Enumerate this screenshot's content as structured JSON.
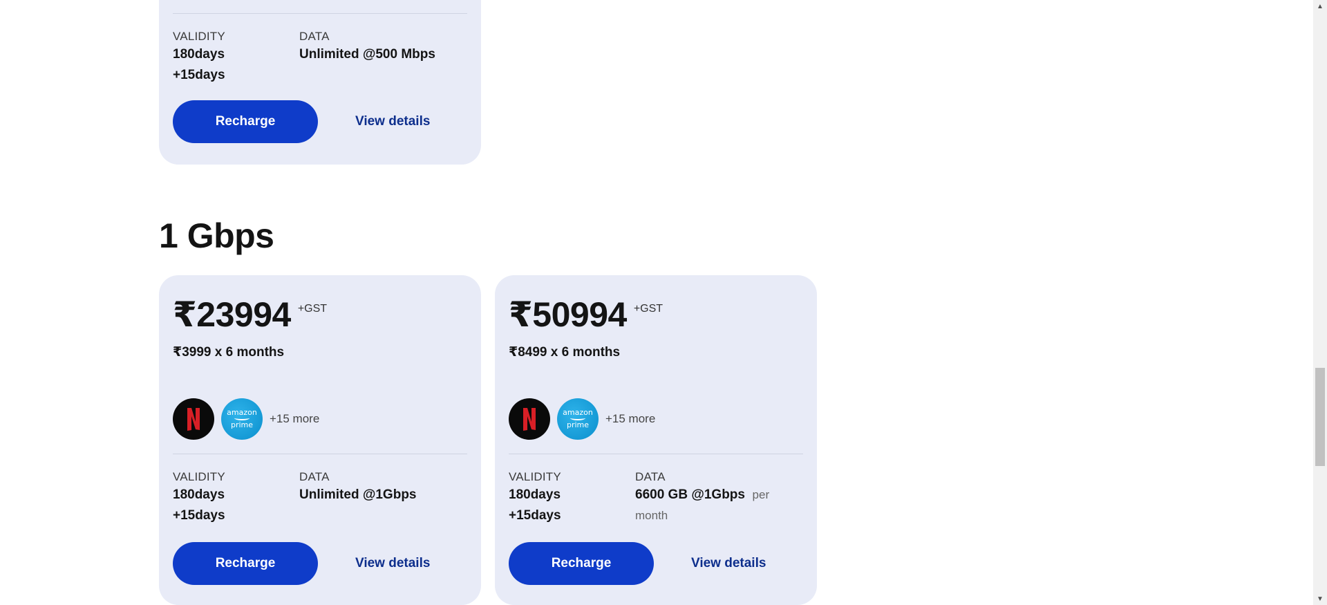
{
  "top_card": {
    "validity_label": "VALIDITY",
    "validity_line1": "180days",
    "validity_line2": "+15days",
    "data_label": "DATA",
    "data_value": "Unlimited @500 Mbps",
    "recharge_label": "Recharge",
    "details_label": "View details"
  },
  "section": {
    "title": "1 Gbps"
  },
  "plans": [
    {
      "price": "₹23994",
      "gst": "+GST",
      "monthly": "₹3999 x 6 months",
      "ott_more": "+15 more",
      "validity_label": "VALIDITY",
      "validity_line1": "180days",
      "validity_line2": "+15days",
      "data_label": "DATA",
      "data_value": "Unlimited @1Gbps",
      "recharge_label": "Recharge",
      "details_label": "View details"
    },
    {
      "price": "₹50994",
      "gst": "+GST",
      "monthly": "₹8499 x 6 months",
      "ott_more": "+15 more",
      "validity_label": "VALIDITY",
      "validity_line1": "180days",
      "validity_line2": "+15days",
      "data_label": "DATA",
      "data_value": "6600 GB @1Gbps",
      "data_suffix_1": "per",
      "data_suffix_2": "month",
      "recharge_label": "Recharge",
      "details_label": "View details"
    }
  ],
  "ott_logos": {
    "netflix_letter": "N",
    "prime_line1": "amazon",
    "prime_line2": "prime"
  },
  "colors": {
    "card_bg": "#e8ebf7",
    "button_bg": "#0f3cc9",
    "link": "#0d2e8c"
  }
}
